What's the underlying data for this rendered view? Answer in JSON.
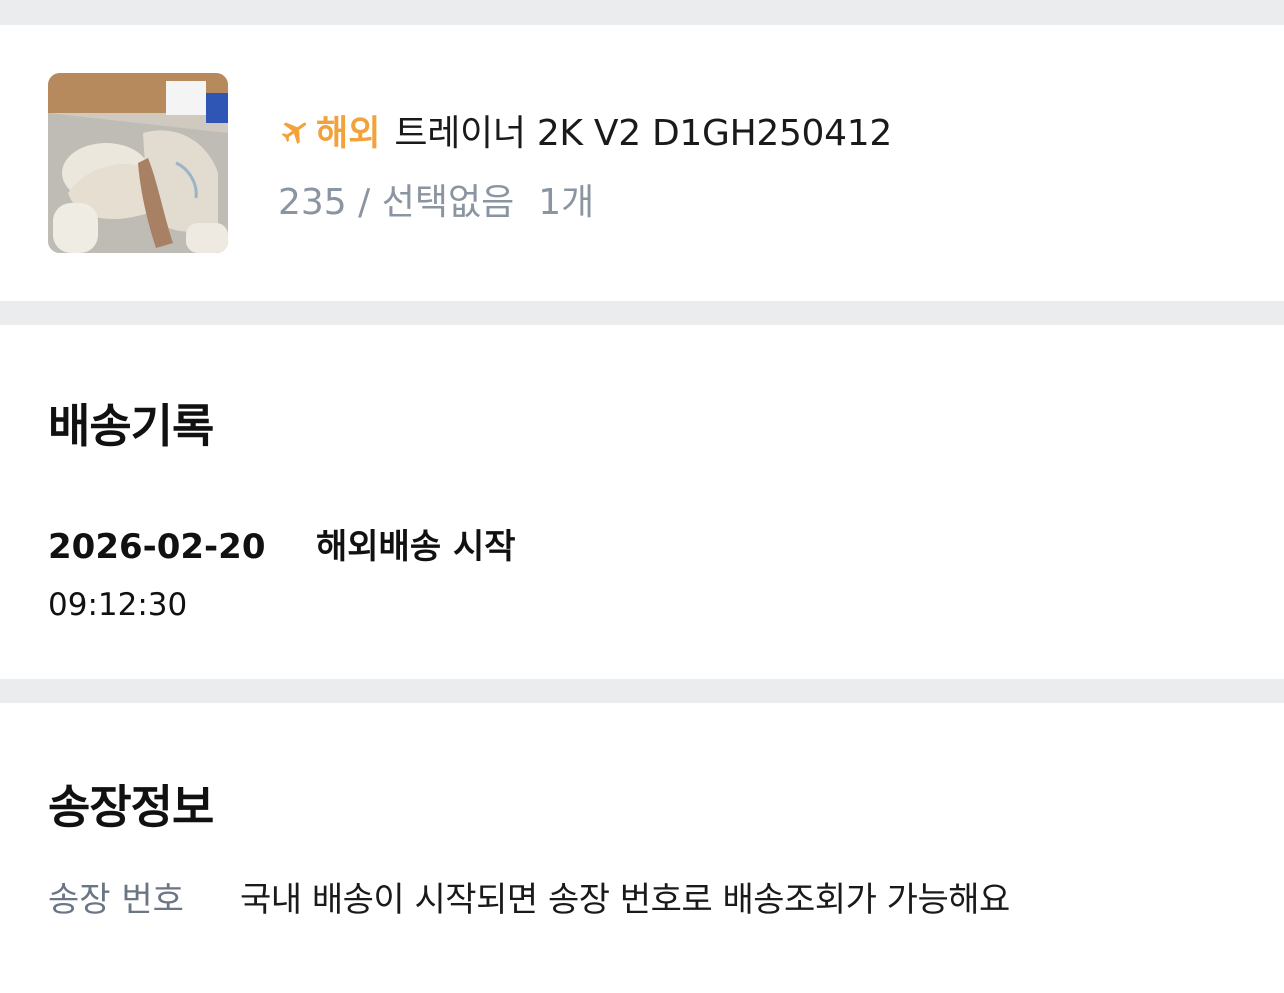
{
  "product": {
    "badge_label": "해외",
    "name": "트레이너 2K V2 D1GH250412",
    "option": "235 / 선택없음",
    "quantity": "1개",
    "badge_color": "#f2a23a",
    "image_icon": "sneaker-photo"
  },
  "history": {
    "title": "배송기록",
    "entries": [
      {
        "date": "2026-02-20",
        "status": "해외배송 시작",
        "time": "09:12:30"
      }
    ]
  },
  "invoice": {
    "title": "송장정보",
    "label": "송장 번호",
    "value": "국내 배송이 시작되면 송장 번호로 배송조회가 가능해요"
  }
}
